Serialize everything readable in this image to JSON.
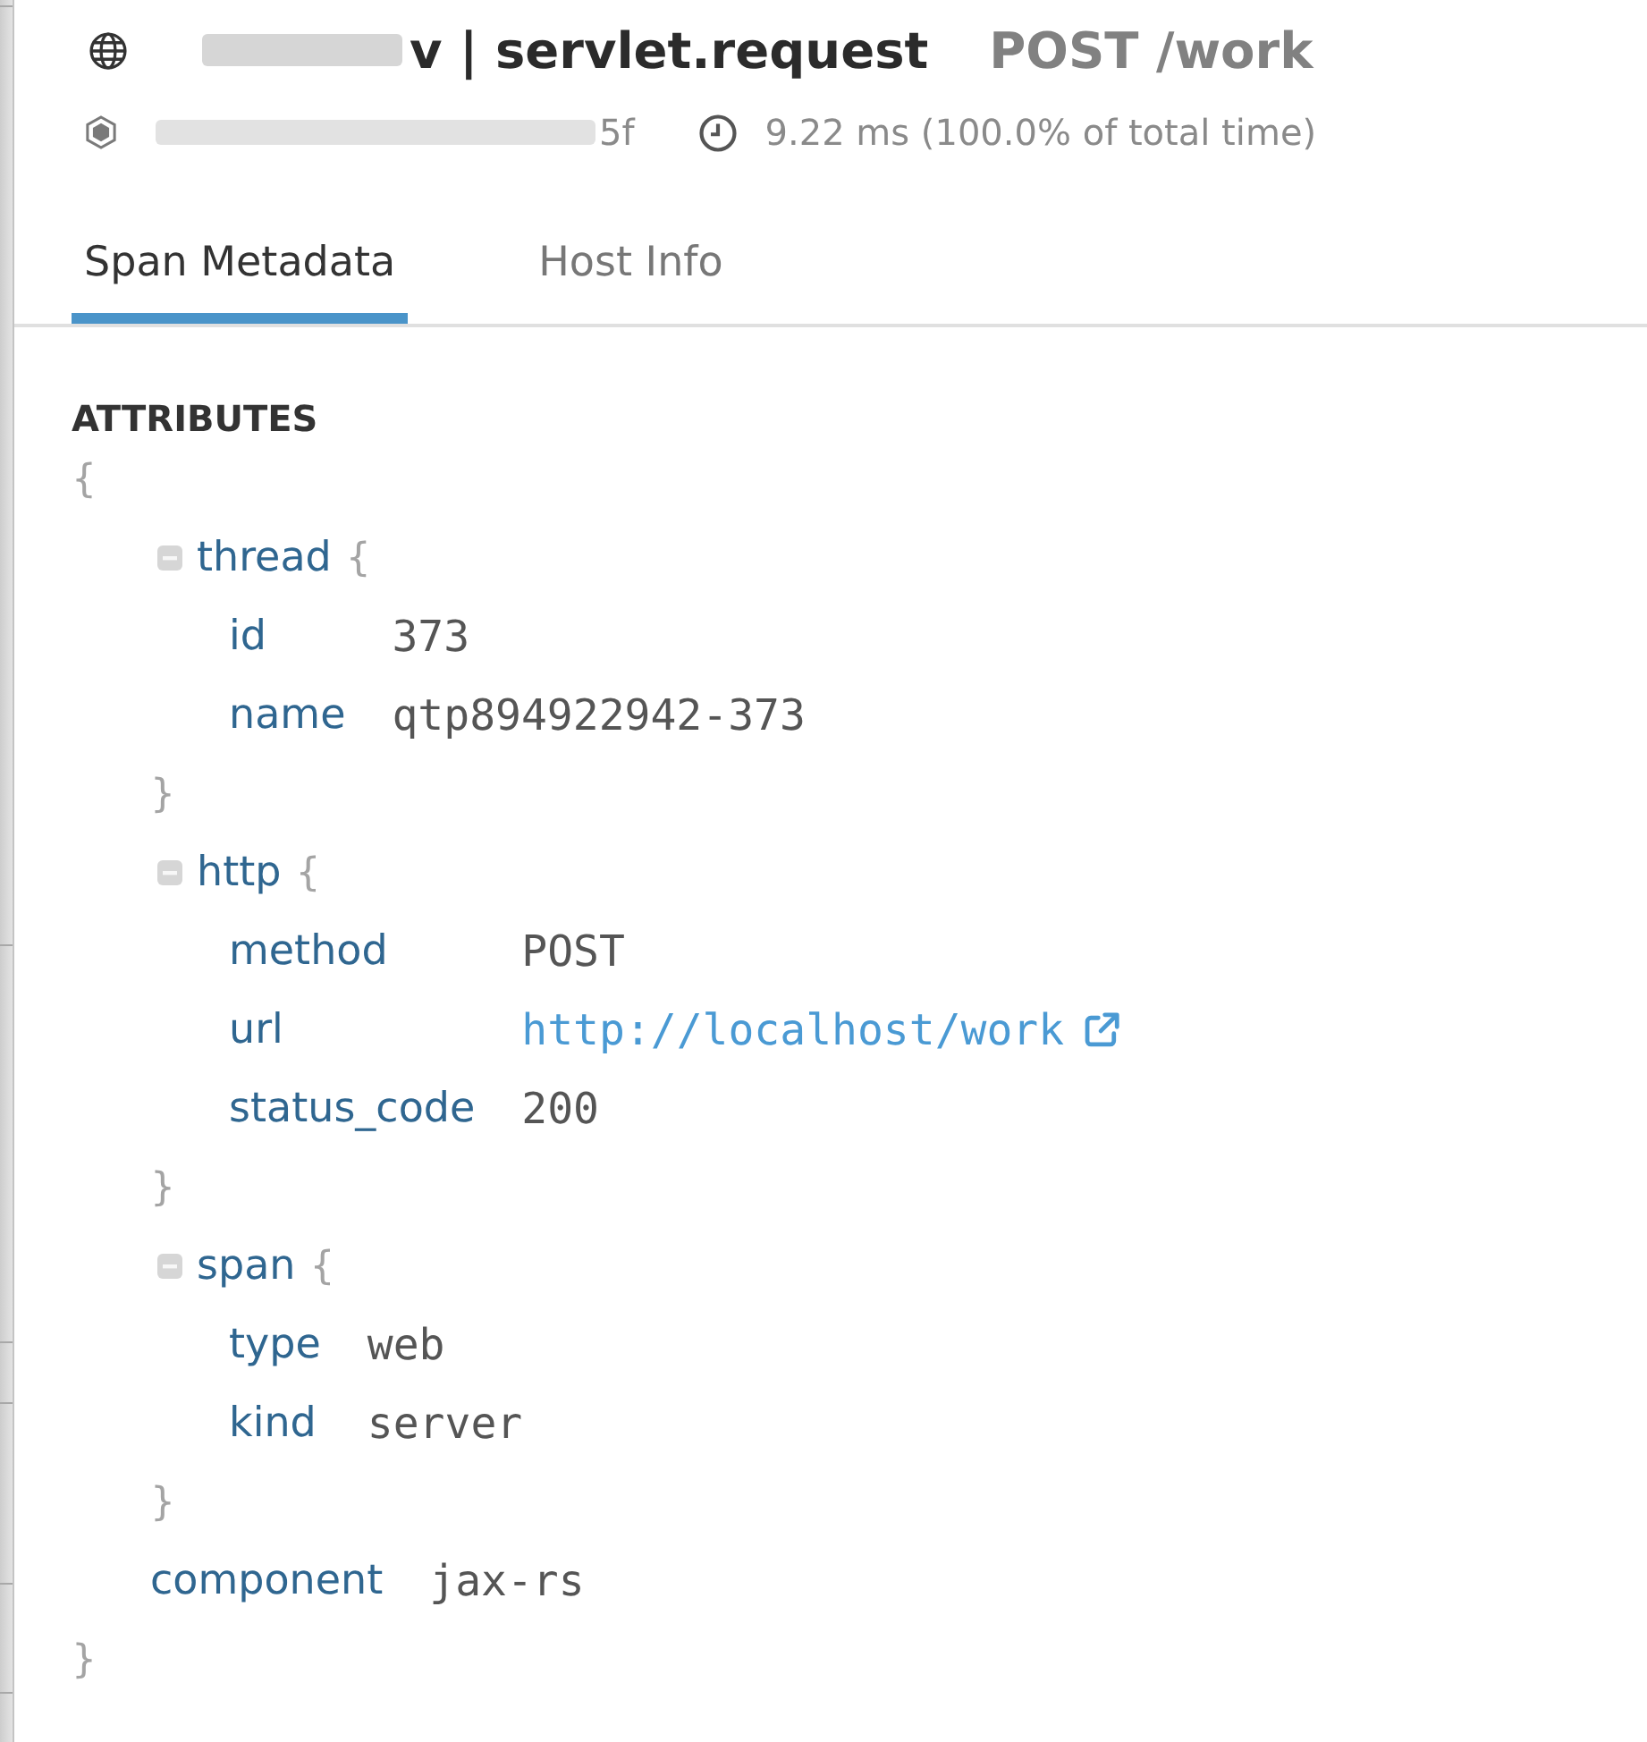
{
  "header": {
    "title": "v | servlet.request",
    "resource": "POST /work",
    "trace_id": "5f",
    "duration": "9.22 ms (100.0% of total time)"
  },
  "tabs": [
    {
      "label": "Span Metadata",
      "selected": true
    },
    {
      "label": "Host Info",
      "selected": false
    }
  ],
  "attributes": {
    "heading": "ATTRIBUTES",
    "open_brace": "{",
    "close_brace": "}",
    "children": [
      {
        "kind": "object",
        "key": "thread",
        "expanded": true,
        "open_brace": "{",
        "close_brace": "}",
        "children": [
          {
            "kind": "text",
            "key": "id",
            "value": "373"
          },
          {
            "kind": "text",
            "key": "name",
            "value": "qtp894922942-373"
          }
        ]
      },
      {
        "kind": "object",
        "key": "http",
        "expanded": true,
        "open_brace": "{",
        "close_brace": "}",
        "children": [
          {
            "kind": "text",
            "key": "method",
            "value": "POST"
          },
          {
            "kind": "link",
            "key": "url",
            "value": "http://localhost/work"
          },
          {
            "kind": "text",
            "key": "status_code",
            "value": "200"
          }
        ]
      },
      {
        "kind": "object",
        "key": "span",
        "expanded": true,
        "open_brace": "{",
        "close_brace": "}",
        "children": [
          {
            "kind": "text",
            "key": "type",
            "value": "web"
          },
          {
            "kind": "text",
            "key": "kind",
            "value": "server"
          }
        ]
      },
      {
        "kind": "text",
        "key": "component",
        "value": "jax-rs"
      }
    ]
  }
}
